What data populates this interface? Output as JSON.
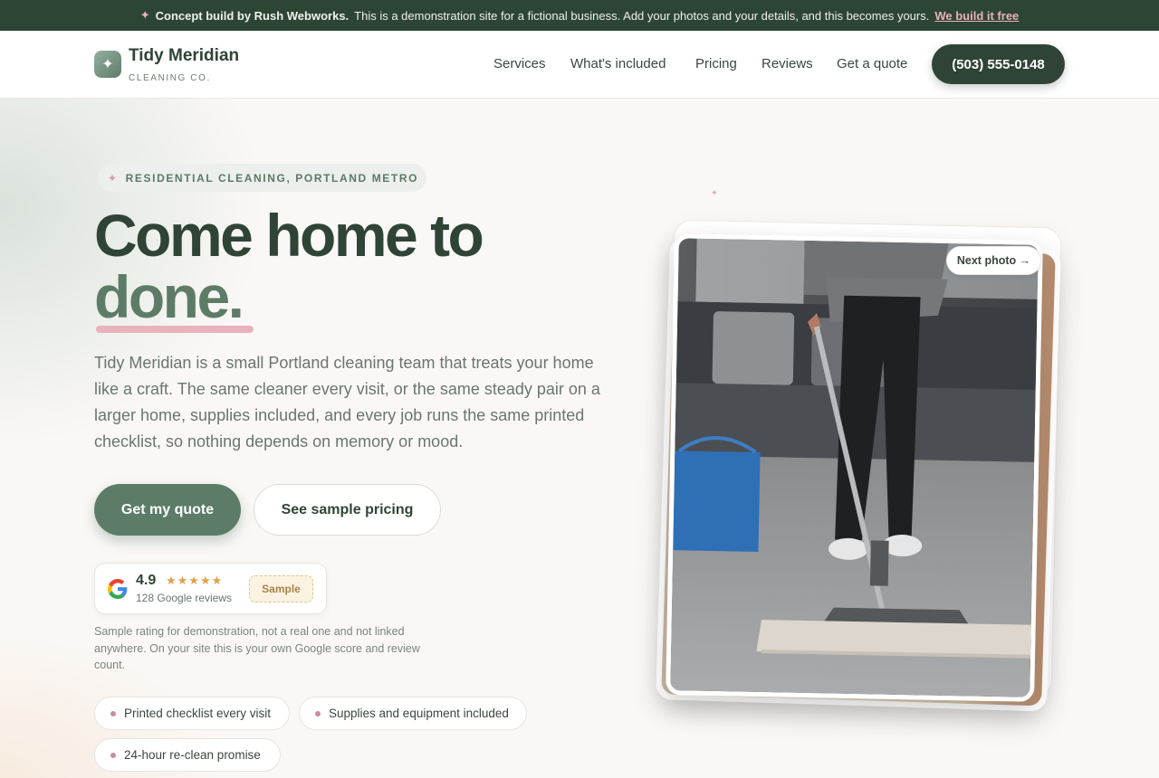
{
  "banner": {
    "spark": "✦",
    "lead": "Concept build by Rush Webworks.",
    "text": "This is a demonstration site for a fictional business. Add your photos and your details, and this becomes yours.",
    "link": "We build it free"
  },
  "brand": {
    "icon": "sparkle-icon",
    "name": "Tidy Meridian",
    "sub": "CLEANING CO."
  },
  "nav": {
    "items": [
      "Services",
      "What's included",
      "Pricing",
      "Reviews",
      "Get a quote"
    ],
    "phone": "(503) 555-0148"
  },
  "hero": {
    "eyebrow": "RESIDENTIAL CLEANING, PORTLAND METRO",
    "headline_1": "Come home to",
    "headline_2": "done.",
    "lede": "Tidy Meridian is a small Portland cleaning team that treats your home like a craft. The same cleaner every visit, or the same steady pair on a larger home, supplies included, and every job runs the same printed checklist, so nothing depends on memory or mood.",
    "cta_primary": "Get my quote",
    "cta_secondary": "See sample pricing"
  },
  "rating": {
    "score": "4.9",
    "stars": "★★★★★",
    "count": "128 Google reviews",
    "badge": "Sample",
    "disclaimer": "Sample rating for demonstration, not a real one and not linked anywhere. On your site this is your own Google score and review count."
  },
  "features": [
    "Printed checklist every visit",
    "Supplies and equipment included",
    "24-hour re-clean promise"
  ],
  "gallery": {
    "next_label": "Next photo →"
  },
  "colors": {
    "brand_dark": "#2f4436",
    "brand_green": "#5d7c68",
    "accent_pink": "#e8b3bd",
    "banner_bg": "#2d4535"
  }
}
